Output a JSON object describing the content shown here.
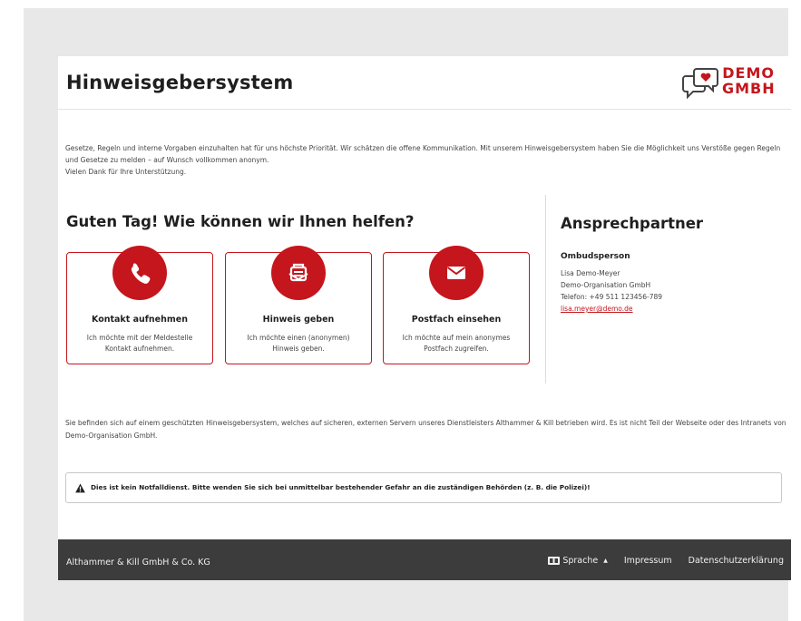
{
  "header": {
    "title": "Hinweisgebersystem",
    "logo_line1": "DEMO",
    "logo_line2": "GMBH"
  },
  "intro": {
    "line1": "Gesetze, Regeln und interne Vorgaben einzuhalten hat für uns höchste Priorität. Wir schätzen die offene Kommunikation. Mit unserem Hinweisgebersystem haben Sie die Möglichkeit uns Verstöße gegen Regeln und Gesetze zu melden – auf Wunsch vollkommen anonym.",
    "line2": "Vielen Dank für Ihre Unterstützung."
  },
  "main": {
    "greeting": "Guten Tag! Wie können wir Ihnen helfen?",
    "cards": [
      {
        "icon": "phone-icon",
        "title": "Kontakt aufnehmen",
        "desc": "Ich möchte mit der Meldestelle Kontakt aufnehmen."
      },
      {
        "icon": "report-icon",
        "title": "Hinweis geben",
        "desc": "Ich möchte einen (anonymen) Hinweis geben."
      },
      {
        "icon": "mail-icon",
        "title": "Postfach einsehen",
        "desc": "Ich möchte auf mein anonymes Postfach zugreifen."
      }
    ]
  },
  "contact": {
    "heading": "Ansprechpartner",
    "role": "Ombudsperson",
    "name": "Lisa Demo-Meyer",
    "org": "Demo-Organisation GmbH",
    "phone": "Telefon: +49 511 123456-789",
    "email": "lisa.meyer@demo.de"
  },
  "secure_note": "Sie befinden sich auf einem geschützten Hinweisgebersystem, welches auf sicheren, externen Servern unseres Dienstleisters Althammer & Kill betrieben wird. Es ist nicht Teil der Webseite oder des Intranets von Demo-Organisation GmbH.",
  "notice": "Dies ist kein Notfalldienst. Bitte wenden Sie sich bei unmittelbar bestehender Gefahr an die zuständigen Behörden (z. B. die Polizei)!",
  "footer": {
    "company": "Althammer & Kill GmbH & Co. KG",
    "language": "Sprache",
    "imprint": "Impressum",
    "privacy": "Datenschutzerklärung"
  },
  "colors": {
    "brand_red": "#c4161c",
    "footer_bg": "#3c3c3c"
  }
}
